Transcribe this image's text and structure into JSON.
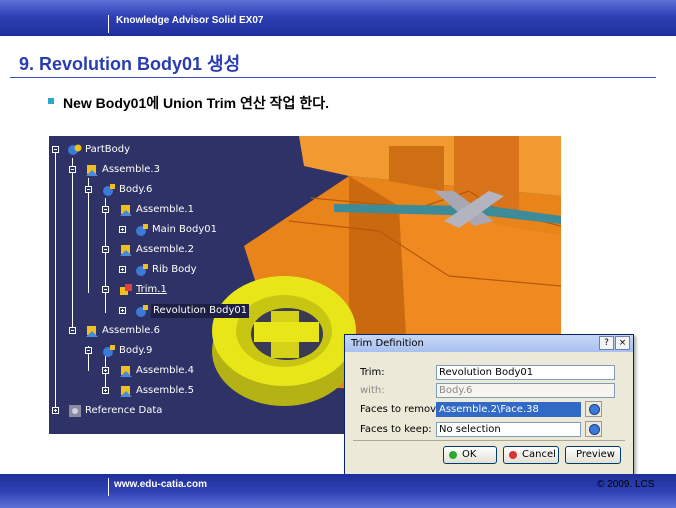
{
  "header": {
    "title": "Knowledge Advisor Solid EX07"
  },
  "slide": {
    "title": "9. Revolution Body01 생성",
    "bullet": "New Body01에 Union Trim 연산 작업 한다."
  },
  "tree": {
    "nodes": [
      {
        "label": "PartBody",
        "icon": "partbody-icon"
      },
      {
        "label": "Assemble.3",
        "icon": "assemble-icon"
      },
      {
        "label": "Body.6",
        "icon": "body-icon"
      },
      {
        "label": "Assemble.1",
        "icon": "assemble-icon"
      },
      {
        "label": "Main Body01",
        "icon": "body-icon"
      },
      {
        "label": "Assemble.2",
        "icon": "assemble-icon"
      },
      {
        "label": "Rib Body",
        "icon": "body-icon"
      },
      {
        "label": "Trim.1",
        "icon": "trim-icon"
      },
      {
        "label": "Revolution Body01",
        "icon": "body-icon"
      },
      {
        "label": "Assemble.6",
        "icon": "assemble-icon"
      },
      {
        "label": "Body.9",
        "icon": "body-icon"
      },
      {
        "label": "Assemble.4",
        "icon": "assemble-icon"
      },
      {
        "label": "Assemble.5",
        "icon": "assemble-icon"
      },
      {
        "label": "Reference Data",
        "icon": "reference-data-icon"
      }
    ]
  },
  "dialog": {
    "title": "Trim Definition",
    "help": "?",
    "close": "×",
    "fields": {
      "trim_label": "Trim:",
      "trim_value": "Revolution Body01",
      "with_label": "with:",
      "with_value": "Body.6",
      "remove_label": "Faces to remove:",
      "remove_value": "Assemble.2\\Face.38",
      "keep_label": "Faces to keep:",
      "keep_value": "No selection"
    },
    "buttons": {
      "ok": "OK",
      "cancel": "Cancel",
      "preview": "Preview"
    },
    "colors": {
      "ok_dot": "#2da82d",
      "cancel_dot": "#d83434"
    }
  },
  "footer": {
    "url": "www.edu-catia.com",
    "copyright": "© 2009. LCS"
  },
  "colors": {
    "band": "#2e40b4",
    "title": "#2a3db0",
    "bullet": "#2ea7c9",
    "viewport": "#2e3266",
    "part_orange": "#e8841a",
    "ring_yellow": "#e8e618"
  }
}
